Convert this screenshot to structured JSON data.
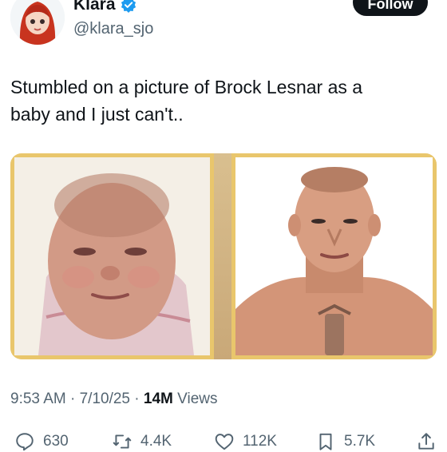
{
  "author": {
    "display_name": "Klara",
    "handle": "@klara_sjo",
    "verified": true,
    "follow_label": "Follow"
  },
  "tweet": {
    "text": "Stumbled on a picture of Brock Lesnar as a\nbaby and I just can't.."
  },
  "meta": {
    "time": "9:53 AM",
    "date": "7/10/25",
    "separator": "·",
    "views_count": "14M",
    "views_label": "Views"
  },
  "actions": {
    "replies": "630",
    "retweets": "4.4K",
    "likes": "112K",
    "bookmarks": "5.7K"
  },
  "colors": {
    "verified_blue": "#1d9bf0",
    "secondary_text": "#536471",
    "frame_gold": "#e9c66c"
  }
}
